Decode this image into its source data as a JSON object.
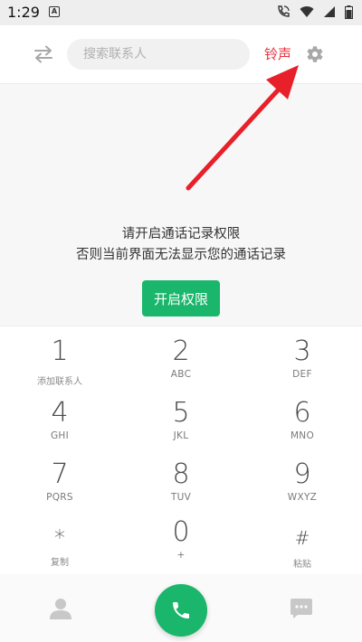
{
  "status_bar": {
    "time": "1:29",
    "notification_icon": "A",
    "icons": [
      "wifi-calling-icon",
      "wifi-icon",
      "signal-icon",
      "battery-icon"
    ]
  },
  "topbar": {
    "search_placeholder": "搜索联系人",
    "ringtone_label": "铃声",
    "left_icon": "swap-icon",
    "right_icon": "gear-icon"
  },
  "permission": {
    "line1": "请开启通话记录权限",
    "line2": "否则当前界面无法显示您的通话记录",
    "button_label": "开启权限"
  },
  "dialpad": {
    "keys": [
      {
        "digit": "1",
        "sub": "添加联系人"
      },
      {
        "digit": "2",
        "sub": "ABC"
      },
      {
        "digit": "3",
        "sub": "DEF"
      },
      {
        "digit": "4",
        "sub": "GHI"
      },
      {
        "digit": "5",
        "sub": "JKL"
      },
      {
        "digit": "6",
        "sub": "MNO"
      },
      {
        "digit": "7",
        "sub": "PQRS"
      },
      {
        "digit": "8",
        "sub": "TUV"
      },
      {
        "digit": "9",
        "sub": "WXYZ"
      },
      {
        "digit": "*",
        "sub": "复制"
      },
      {
        "digit": "0",
        "sub": "+"
      },
      {
        "digit": "#",
        "sub": "粘贴"
      }
    ]
  },
  "bottom_bar": {
    "left_icon": "contact-icon",
    "center_icon": "phone-icon",
    "right_icon": "message-icon"
  },
  "colors": {
    "accent_green": "#1ab66b",
    "ringtone_red": "#e8333d",
    "arrow_red": "#e8202a"
  }
}
